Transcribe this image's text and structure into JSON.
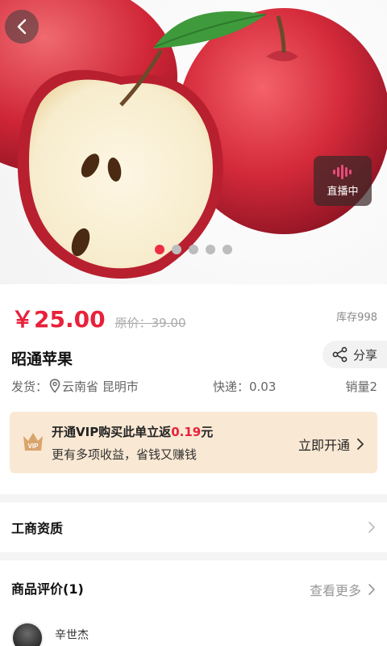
{
  "hero": {
    "back_icon": "chevron-left-icon",
    "live_label": "直播中",
    "live_icon": "soundwave-icon",
    "carousel_count": 5,
    "carousel_active": 1
  },
  "product": {
    "price": "￥25.00",
    "original_price": "原价：39.00",
    "stock": "库存998",
    "title": "昭通苹果",
    "share_label": "分享",
    "ship_label": "发货：",
    "ship_location": "云南省 昆明市",
    "express": "快递：0.03",
    "sales": "销量2"
  },
  "vip": {
    "badge": "VIP",
    "line1_prefix": "开通VIP购买此单立返",
    "line1_amount": "0.19",
    "line1_suffix": "元",
    "line2": "更有多项收益，省钱又赚钱",
    "cta": "立即开通"
  },
  "business": {
    "label": "工商资质"
  },
  "reviews": {
    "title": "商品评价(1)",
    "more": "查看更多",
    "first_user": "辛世杰"
  },
  "colors": {
    "accent": "#e8213a",
    "vip_bg": "#f9e8d3"
  }
}
